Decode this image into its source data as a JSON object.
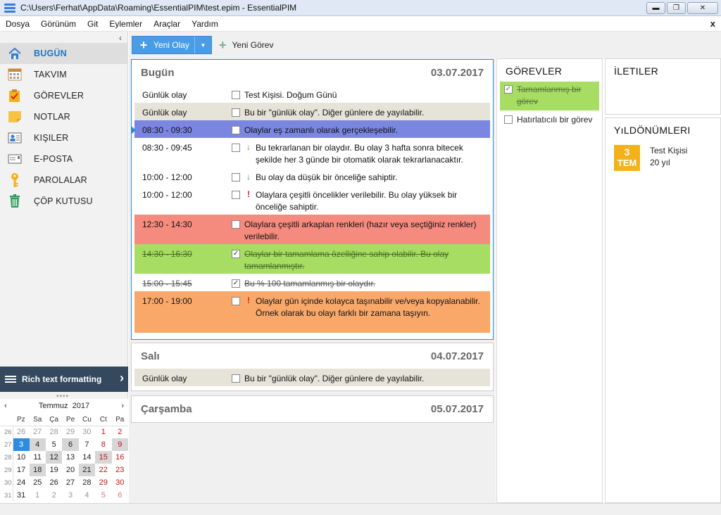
{
  "window": {
    "title": "C:\\Users\\Ferhat\\AppData\\Roaming\\EssentialPIM\\test.epim - EssentialPIM",
    "close_menu": "x"
  },
  "menu": [
    "Dosya",
    "Görünüm",
    "Git",
    "Eylemler",
    "Araçlar",
    "Yardım"
  ],
  "sidebar": {
    "collapse": "‹",
    "items": [
      {
        "label": "BUGÜN",
        "icon": "home-icon"
      },
      {
        "label": "TAKVIM",
        "icon": "calendar-icon"
      },
      {
        "label": "GÖREVLER",
        "icon": "tasks-icon"
      },
      {
        "label": "NOTLAR",
        "icon": "notes-icon"
      },
      {
        "label": "KIŞILER",
        "icon": "contacts-icon"
      },
      {
        "label": "E-POSTA",
        "icon": "mail-icon"
      },
      {
        "label": "PAROLALAR",
        "icon": "key-icon"
      },
      {
        "label": "ÇÖP KUTUSU",
        "icon": "trash-icon"
      }
    ],
    "rich_text": "Rich text formatting"
  },
  "minical": {
    "month": "Temmuz",
    "year": "2017",
    "weekdays": [
      "Pz",
      "Sa",
      "Ça",
      "Pe",
      "Cu",
      "Ct",
      "Pa"
    ]
  },
  "toolbar": {
    "new_event": "Yeni Olay",
    "new_task": "Yeni Görev"
  },
  "days": [
    {
      "name": "Bugün",
      "date": "03.07.2017",
      "events": [
        {
          "time": "Günlük olay",
          "text": "Test Kişisi. Doğum Günü"
        },
        {
          "time": "Günlük olay",
          "text": "Bu bir \"günlük olay\". Diğer günlere de yayılabilir."
        },
        {
          "time": "08:30 - 09:30",
          "text": "Olaylar eş zamanlı olarak gerçekleşebilir."
        },
        {
          "time": "08:30 - 09:45",
          "priority": "↓",
          "text": "Bu tekrarlanan bir olaydır. Bu olay 3 hafta sonra bitecek şekilde her 3 günde bir otomatik olarak tekrarlanacaktır."
        },
        {
          "time": "10:00 - 12:00",
          "priority": "↓",
          "text": "Bu olay da düşük bir önceliğe sahiptir."
        },
        {
          "time": "10:00 - 12:00",
          "priority": "!",
          "text": "Olaylara çeşitli öncelikler verilebilir. Bu olay yüksek bir önceliğe sahiptir."
        },
        {
          "time": "12:30 - 14:30",
          "text": "Olaylara çeşitli arkaplan renkleri (hazır veya seçtiğiniz renkler) verilebilir."
        },
        {
          "time": "14:30 - 16:30",
          "check": "✓",
          "text": "Olaylar bir tamamlama özelliğine sahip olabilir. Bu olay tamamlanmıştır."
        },
        {
          "time": "15:00 - 15:45",
          "check": "✓",
          "text": "Bu % 100 tamamlanmış bir olaydır."
        },
        {
          "time": "17:00 - 19:00",
          "priority": "!",
          "text": "Olaylar gün içinde kolayca taşınabilir ve/veya kopyalanabilir. Örnek olarak bu olayı farklı bir zamana taşıyın."
        }
      ]
    },
    {
      "name": "Salı",
      "date": "04.07.2017",
      "events": [
        {
          "time": "Günlük olay",
          "text": "Bu bir \"günlük olay\". Diğer günlere de yayılabilir."
        }
      ]
    },
    {
      "name": "Çarşamba",
      "date": "05.07.2017"
    }
  ],
  "tasks": {
    "title": "GÖREVLER",
    "items": [
      {
        "text": "Tamamlanmış bir görev",
        "check": "✓"
      },
      {
        "text": "Hatırlatıcılı bir görev"
      }
    ]
  },
  "messages": {
    "title": "İLETILER"
  },
  "anniversaries": {
    "title": "YıLDÖNÜMLERI",
    "items": [
      {
        "day": "3",
        "month": "TEM",
        "name": "Test Kişisi",
        "years": "20 yıl"
      }
    ]
  },
  "colors": {
    "accent": "#2d8ce0",
    "blue_event": "#7b86e0",
    "red_event": "#f58b7e",
    "green_event": "#a6dd62",
    "orange_event": "#f9a86a",
    "grey_event": "#e6e4d8",
    "badge": "#f3b21b",
    "rich_bar": "#34495e"
  }
}
